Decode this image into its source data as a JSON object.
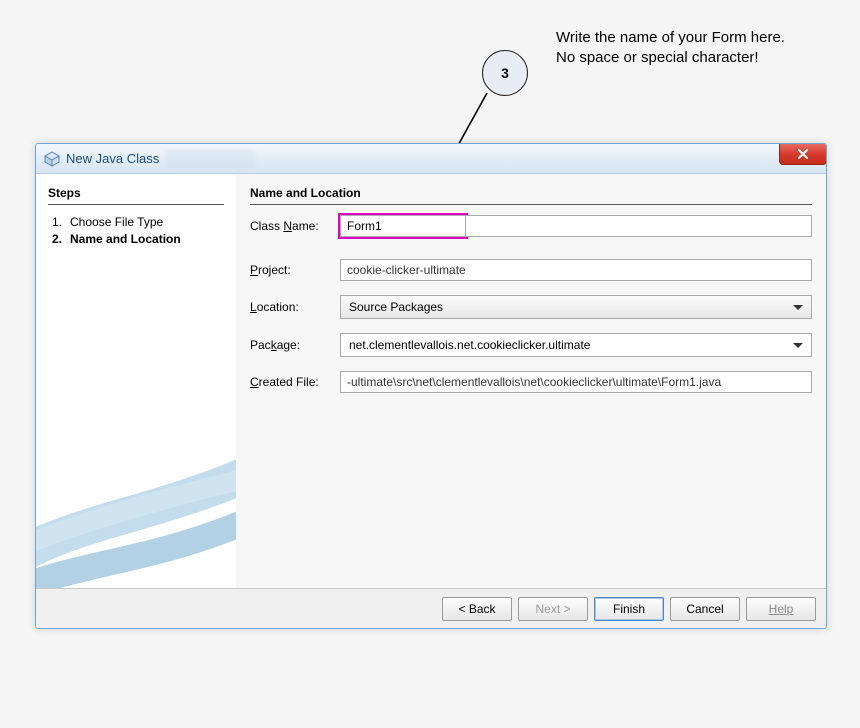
{
  "annotation": {
    "number": "3",
    "line1": "Write the name of your Form here.",
    "line2": "No space or special character!"
  },
  "dialog": {
    "title": "New Java Class"
  },
  "steps": {
    "heading": "Steps",
    "items": [
      {
        "num": "1.",
        "label": "Choose File Type"
      },
      {
        "num": "2.",
        "label": "Name and Location"
      }
    ]
  },
  "form": {
    "heading": "Name and Location",
    "class_name_label_pre": "Class ",
    "class_name_label_mn": "N",
    "class_name_label_post": "ame:",
    "class_name_value": "Form1",
    "project_label_mn": "P",
    "project_label_post": "roject:",
    "project_value": "cookie-clicker-ultimate",
    "location_label_mn": "L",
    "location_label_post": "ocation:",
    "location_value": "Source Packages",
    "package_label_pre": "Pac",
    "package_label_mn": "k",
    "package_label_post": "age:",
    "package_value": "net.clementlevallois.net.cookieclicker.ultimate",
    "created_label_mn": "C",
    "created_label_post": "reated File:",
    "created_value": "-ultimate\\src\\net\\clementlevallois\\net\\cookieclicker\\ultimate\\Form1.java"
  },
  "buttons": {
    "back": "< Back",
    "next": "Next >",
    "finish": "Finish",
    "cancel": "Cancel",
    "help": "Help"
  }
}
